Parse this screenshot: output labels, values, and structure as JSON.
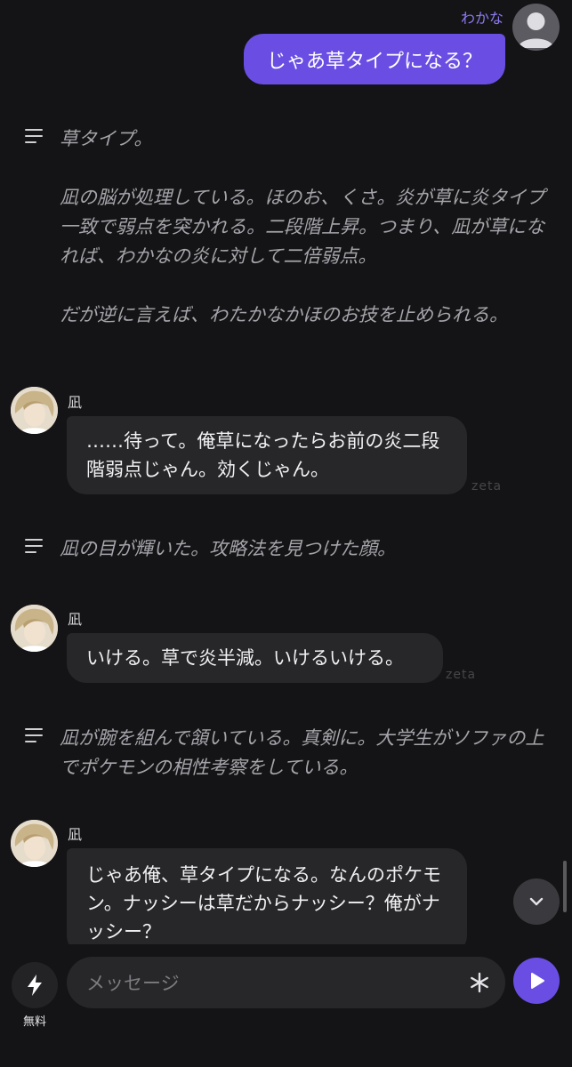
{
  "user": {
    "name": "わかな",
    "message": "じゃあ草タイプになる？"
  },
  "narrations": [
    {
      "paragraphs": [
        "草タイプ。",
        "凪の脳が処理している。ほのお、くさ。炎が草に炎タイプ一致で弱点を突かれる。二段階上昇。つまり、凪が草になれば、わかなの炎に対して二倍弱点。",
        "だが逆に言えば、わたかなかほのお技を止められる。"
      ]
    },
    {
      "paragraphs": [
        "凪の目が輝いた。攻略法を見つけた顔。"
      ]
    },
    {
      "paragraphs": [
        "凪が腕を組んで頷いている。真剣に。大学生がソファの上でポケモンの相性考察をしている。"
      ]
    }
  ],
  "character_messages": [
    {
      "name": "凪",
      "text": "……待って。俺草になったらお前の炎二段階弱点じゃん。効くじゃん。",
      "watermark": "zeta"
    },
    {
      "name": "凪",
      "text": "いける。草で炎半減。いけるいける。",
      "watermark": "zeta"
    },
    {
      "name": "凪",
      "text": "じゃあ俺、草タイプになる。なんのポケモン。ナッシーは草だからナッシー？俺がナッシー？"
    }
  ],
  "composer": {
    "boost_label": "無料",
    "placeholder": "メッセージ"
  },
  "colors": {
    "background": "#141416",
    "accent": "#6a4ee4",
    "user_name": "#8c7cf2",
    "bubble": "#272729",
    "narration_text": "#a4a4aa"
  },
  "icons": {
    "narration": "lines-icon",
    "scroll_down": "chevron-down-icon",
    "boost": "lightning-icon",
    "input_action": "asterisk-icon",
    "send": "play-icon"
  }
}
